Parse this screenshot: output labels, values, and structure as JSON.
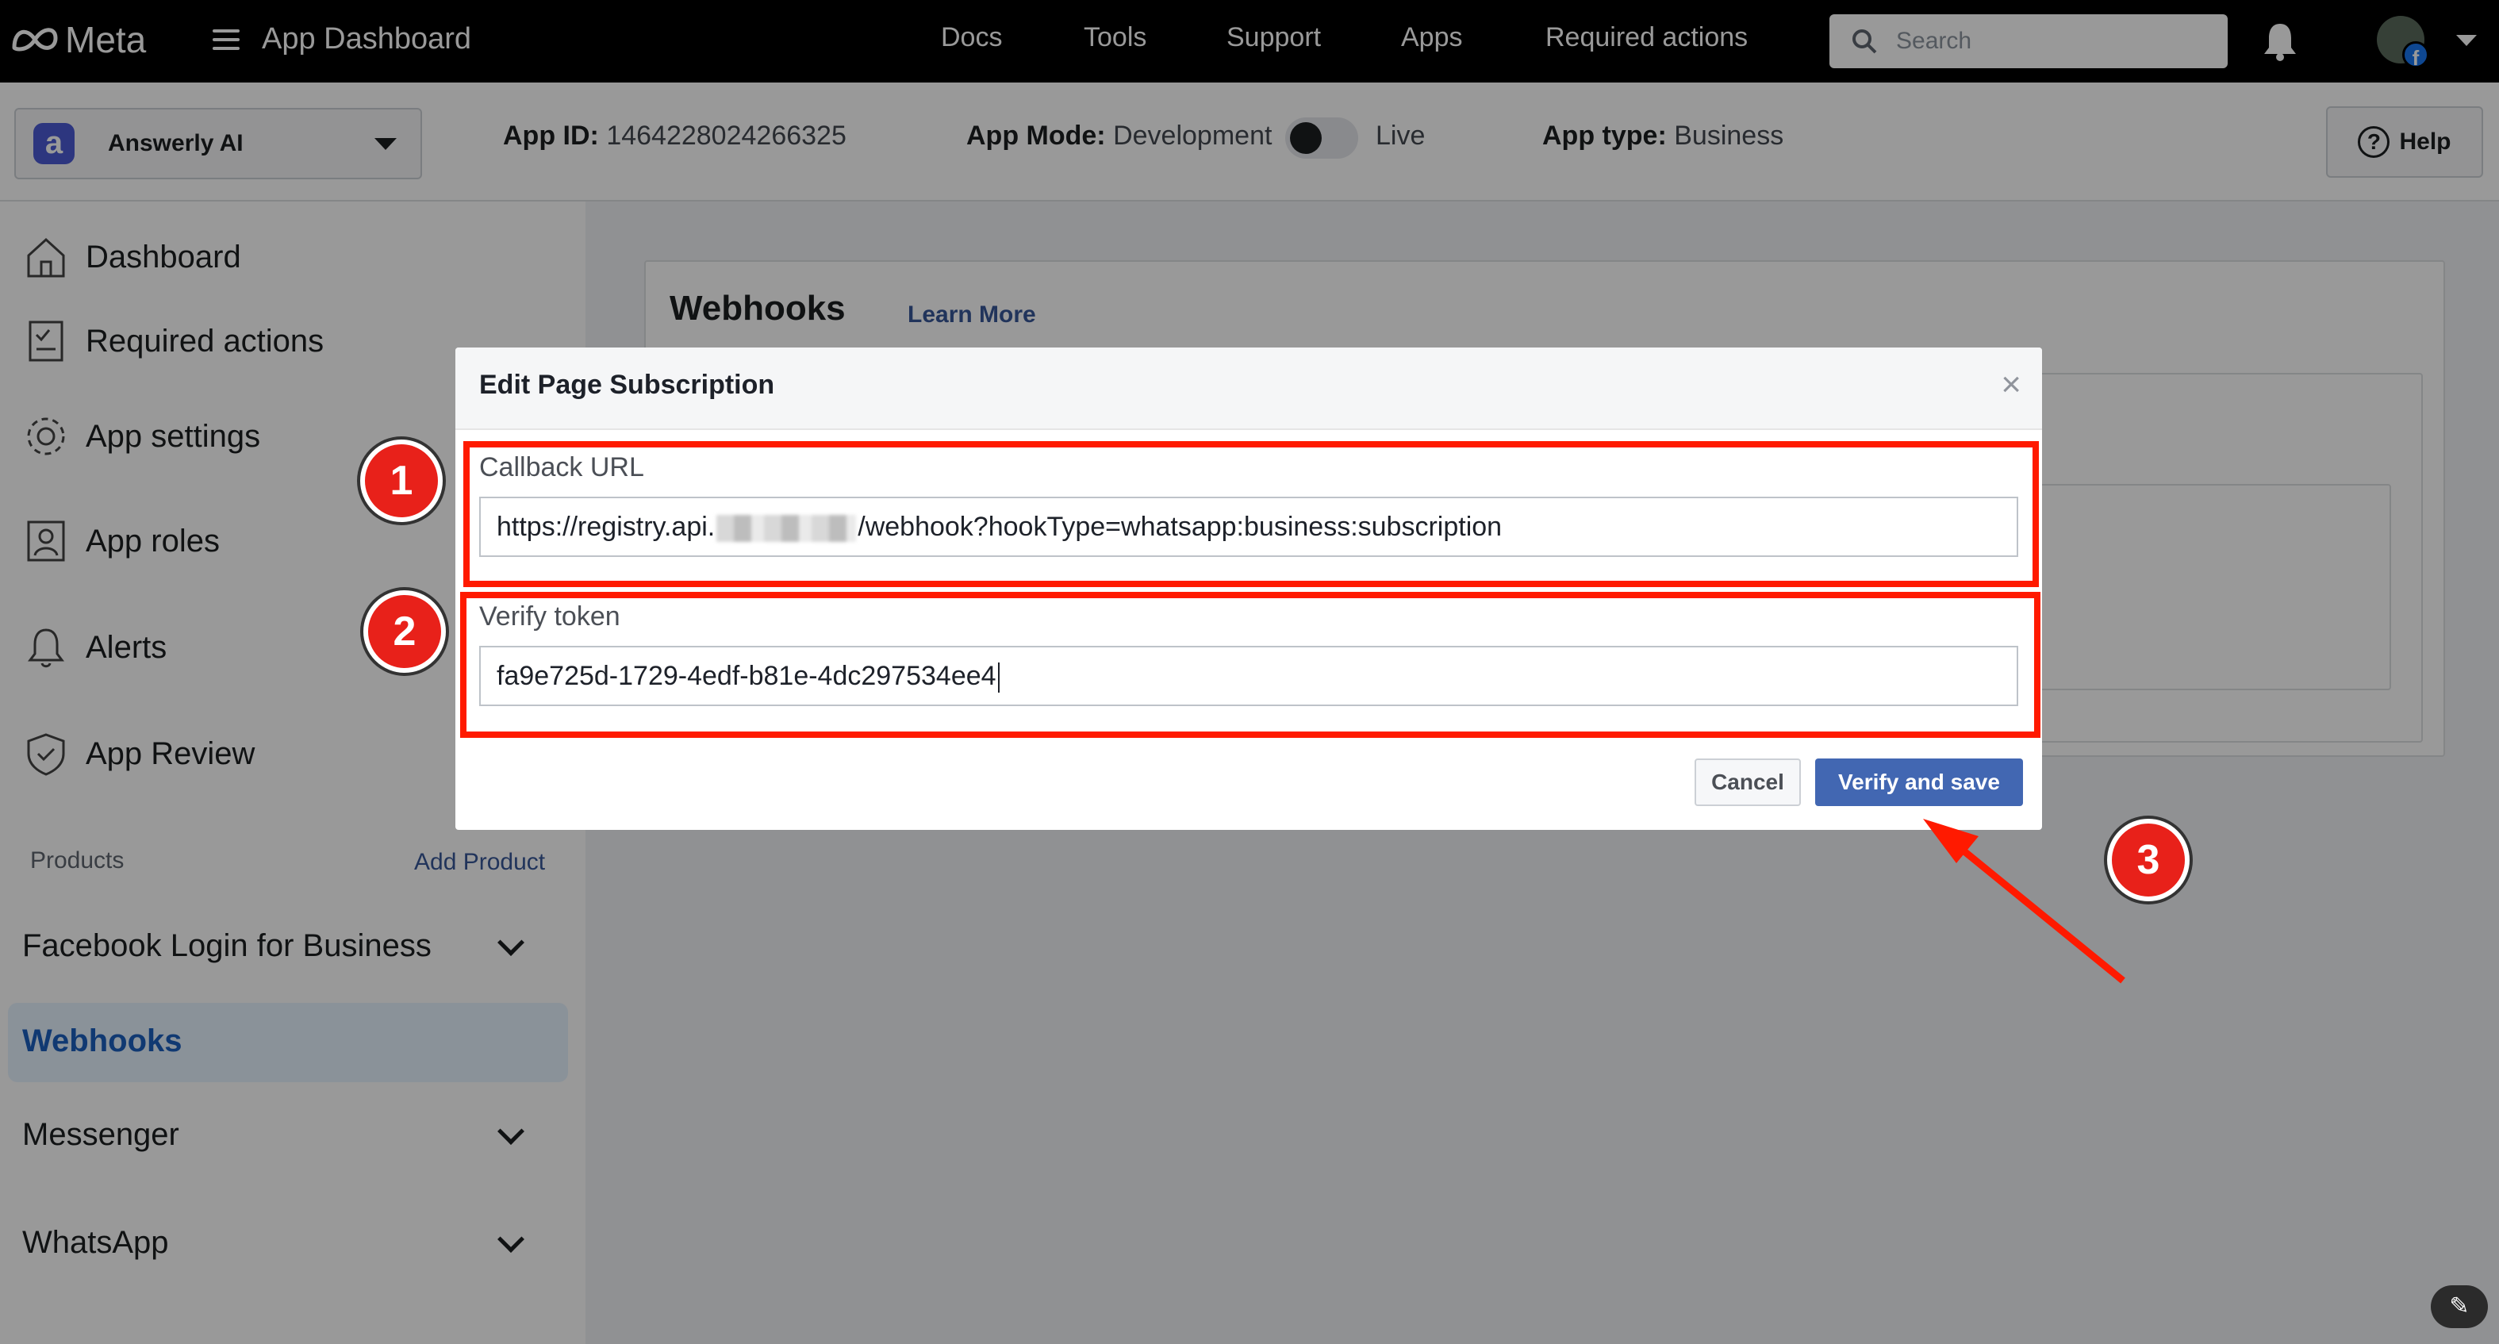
{
  "topbar": {
    "brand": "Meta",
    "app_dashboard": "App Dashboard",
    "nav": [
      "Docs",
      "Tools",
      "Support",
      "Apps",
      "Required actions"
    ],
    "search_placeholder": "Search"
  },
  "appbar": {
    "app_name": "Answerly AI",
    "app_id_label": "App ID:",
    "app_id": "1464228024266325",
    "app_mode_label": "App Mode:",
    "app_mode": "Development",
    "live_label": "Live",
    "app_type_label": "App type:",
    "app_type": "Business",
    "help": "Help"
  },
  "sidebar": {
    "items": [
      {
        "label": "Dashboard",
        "icon": "home-icon"
      },
      {
        "label": "Required actions",
        "icon": "checklist-icon"
      },
      {
        "label": "App settings",
        "icon": "gear-icon"
      },
      {
        "label": "App roles",
        "icon": "user-badge-icon"
      },
      {
        "label": "Alerts",
        "icon": "bell-icon"
      },
      {
        "label": "App Review",
        "icon": "shield-check-icon"
      }
    ],
    "products_label": "Products",
    "add_product": "Add Product",
    "products": [
      "Facebook Login for Business",
      "Webhooks",
      "Messenger",
      "WhatsApp"
    ]
  },
  "main": {
    "card_title": "Webhooks",
    "learn_more": "Learn More"
  },
  "modal": {
    "title": "Edit Page Subscription",
    "close": "×",
    "callback_label": "Callback URL",
    "callback_prefix": "https://registry.api.",
    "callback_suffix": "/webhook?hookType=whatsapp:business:subscription",
    "verify_label": "Verify token",
    "verify_value": "fa9e725d-1729-4edf-b81e-4dc297534ee4",
    "cancel": "Cancel",
    "save": "Verify and save"
  },
  "annotations": {
    "steps": [
      "1",
      "2",
      "3"
    ],
    "color": "#ff1a00"
  },
  "colors": {
    "topbar": "#000000",
    "primary_button": "#4267b2",
    "link": "#385898",
    "active_nav": "#1b5fbf"
  }
}
